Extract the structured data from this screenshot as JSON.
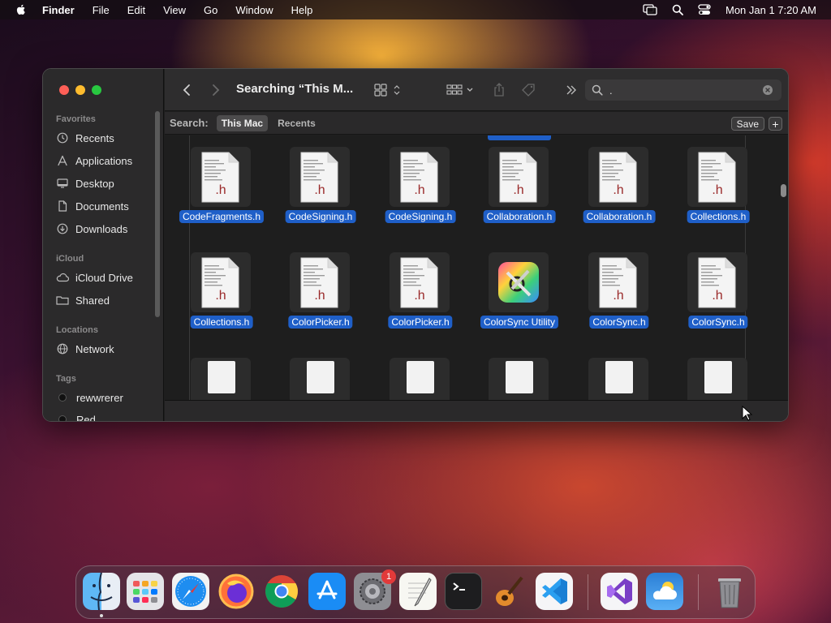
{
  "menubar": {
    "app_name": "Finder",
    "items": [
      "File",
      "Edit",
      "View",
      "Go",
      "Window",
      "Help"
    ],
    "clock": "Mon Jan 1  7:20 AM"
  },
  "window": {
    "title": "Searching “This M...",
    "search_value": "."
  },
  "sidebar": {
    "favorites_label": "Favorites",
    "favorites": [
      {
        "label": "Recents",
        "icon": "clock-icon"
      },
      {
        "label": "Applications",
        "icon": "applications-icon"
      },
      {
        "label": "Desktop",
        "icon": "desktop-icon"
      },
      {
        "label": "Documents",
        "icon": "document-icon"
      },
      {
        "label": "Downloads",
        "icon": "download-icon"
      }
    ],
    "icloud_label": "iCloud",
    "icloud": [
      {
        "label": "iCloud Drive",
        "icon": "cloud-icon"
      },
      {
        "label": "Shared",
        "icon": "shared-folder-icon"
      }
    ],
    "locations_label": "Locations",
    "locations": [
      {
        "label": "Network",
        "icon": "globe-icon"
      }
    ],
    "tags_label": "Tags",
    "tags": [
      {
        "label": "rewwrerer"
      },
      {
        "label": "Red"
      }
    ]
  },
  "scopebar": {
    "label": "Search:",
    "scopes": [
      "This Mac",
      "Recents"
    ],
    "active_scope": "This Mac",
    "save_label": "Save",
    "add_label": "+"
  },
  "files": [
    {
      "name": "CodeFragments.h",
      "kind": "header"
    },
    {
      "name": "CodeSigning.h",
      "kind": "header"
    },
    {
      "name": "CodeSigning.h",
      "kind": "header"
    },
    {
      "name": "Collaboration.h",
      "kind": "header"
    },
    {
      "name": "Collaboration.h",
      "kind": "header"
    },
    {
      "name": "Collections.h",
      "kind": "header"
    },
    {
      "name": "Collections.h",
      "kind": "header"
    },
    {
      "name": "ColorPicker.h",
      "kind": "header"
    },
    {
      "name": "ColorPicker.h",
      "kind": "header"
    },
    {
      "name": "ColorSync Utility",
      "kind": "app"
    },
    {
      "name": "ColorSync.h",
      "kind": "header"
    },
    {
      "name": "ColorSync.h",
      "kind": "header"
    }
  ],
  "file_ext_label": ".h",
  "dock": {
    "apps": [
      "Finder",
      "Launchpad",
      "Safari",
      "Firefox",
      "Chrome",
      "App Store",
      "System Settings",
      "TextEdit",
      "Terminal",
      "GarageBand",
      "Visual Studio Code",
      "Visual Studio",
      "Weather",
      "Trash"
    ],
    "settings_badge": "1"
  },
  "colors": {
    "selection": "#1f5fc8",
    "traffic_close": "#fe5f57",
    "traffic_min": "#febc2e",
    "traffic_max": "#28c840"
  }
}
